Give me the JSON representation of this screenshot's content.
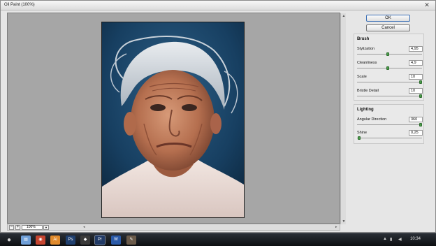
{
  "window": {
    "title": "Oil Paint (100%)"
  },
  "buttons": {
    "ok": "OK",
    "cancel": "Cancel"
  },
  "brush": {
    "title": "Brush",
    "sliders": [
      {
        "label": "Stylization",
        "value": "4,95"
      },
      {
        "label": "Cleanliness",
        "value": "4,9"
      },
      {
        "label": "Scale",
        "value": "10"
      },
      {
        "label": "Bristle Detail",
        "value": "10"
      }
    ]
  },
  "lighting": {
    "title": "Lighting",
    "sliders": [
      {
        "label": "Angular Direction",
        "value": "360"
      },
      {
        "label": "Shine",
        "value": "0,25"
      }
    ]
  },
  "preview": {
    "zoom": "100%"
  },
  "taskbar": {
    "clock": "10:34"
  },
  "icons": [
    "apple-start-icon",
    "finder-icon",
    "chrome-icon",
    "illustrator-icon",
    "photoshop-icon",
    "inkscape-icon",
    "premiere-icon",
    "word-icon",
    "gimp-icon"
  ]
}
